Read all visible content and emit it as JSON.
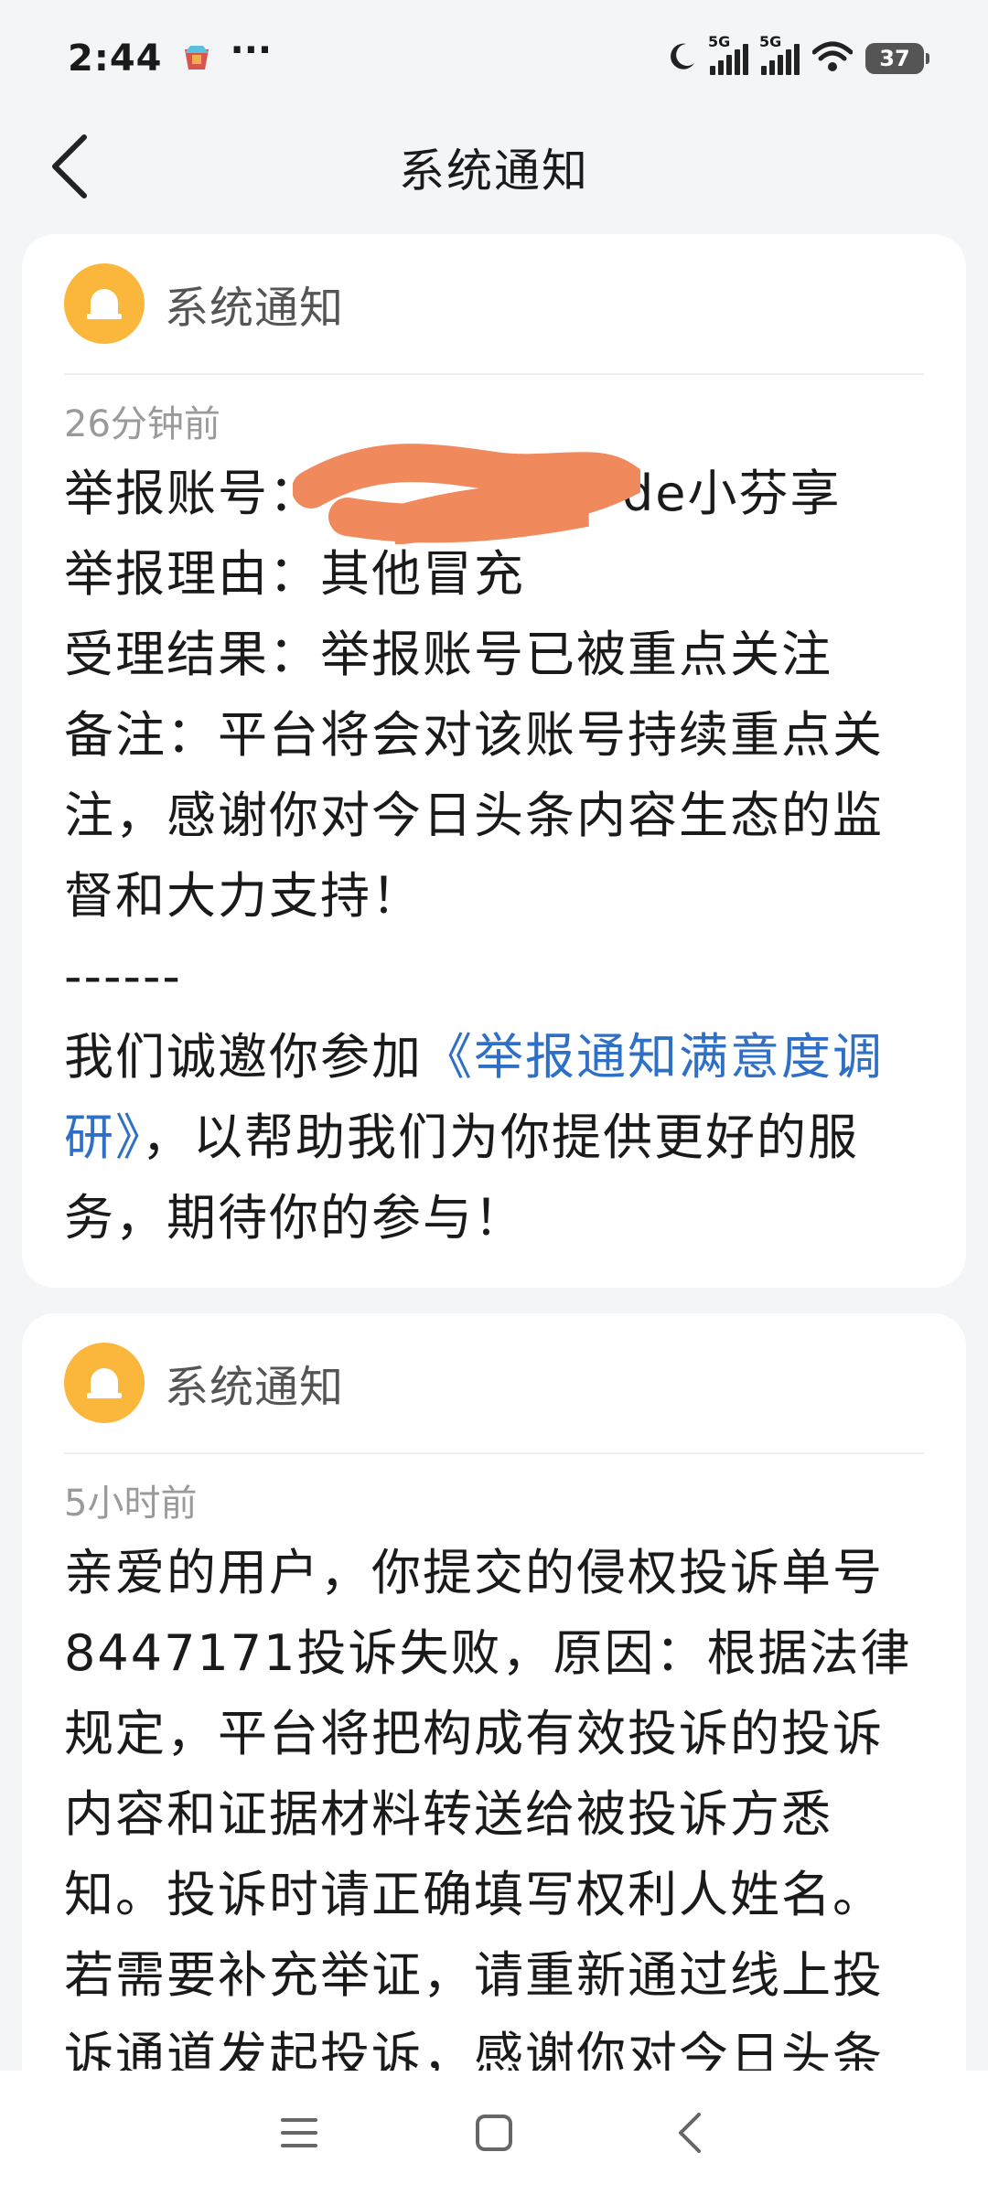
{
  "status_bar": {
    "time": "2:44",
    "dots": "···",
    "network_1": "5G",
    "network_2": "5G",
    "battery": "37"
  },
  "header": {
    "title": "系统通知"
  },
  "notifications": [
    {
      "sender": "系统通知",
      "time": "26分钟前",
      "account_label": "举报账号：",
      "account_value_visible": "de小芬享",
      "reason": "举报理由：其他冒充",
      "result": "受理结果：举报账号已被重点关注",
      "note": "备注：平台将会对该账号持续重点关注，感谢你对今日头条内容生态的监督和大力支持！",
      "divider": "------",
      "invite_prefix": "我们诚邀你参加",
      "invite_link": "《举报通知满意度调研》",
      "invite_suffix": "，以帮助我们为你提供更好的服务，期待你的参与！"
    },
    {
      "sender": "系统通知",
      "time": "5小时前",
      "body": "亲爱的用户，你提交的侵权投诉单号8447171投诉失败，原因：根据法律规定，平台将把构成有效投诉的投诉内容和证据材料转送给被投诉方悉知。投诉时请正确填写权利人姓名。若需要补充举证，请重新通过线上投诉通道发起投诉，感谢你对今日头条"
    }
  ],
  "colors": {
    "bell": "#fbb73c",
    "link": "#2f6fc6",
    "redaction": "#f08a5d"
  },
  "icons": [
    "bell-icon",
    "back-arrow-icon",
    "menu-icon",
    "home-icon",
    "back-icon"
  ]
}
